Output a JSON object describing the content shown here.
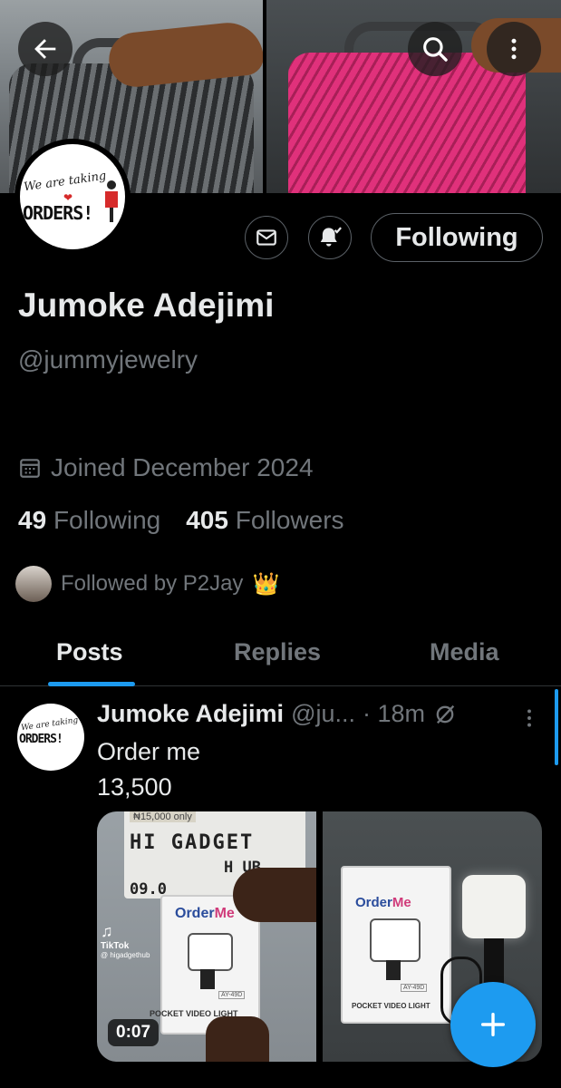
{
  "profile": {
    "name": "Jumoke Adejimi",
    "handle": "@jummyjewelry",
    "joined": "Joined December 2024",
    "following_count": "49",
    "following_label": "Following",
    "followers_count": "405",
    "followers_label": "Followers",
    "followed_by": "Followed by P2Jay",
    "followed_by_emoji": "👑",
    "logo_line1": "We are taking",
    "logo_line2": "ORDERS!"
  },
  "actions": {
    "following_button": "Following"
  },
  "tabs": [
    {
      "label": "Posts",
      "active": true
    },
    {
      "label": "Replies",
      "active": false
    },
    {
      "label": "Media",
      "active": false
    }
  ],
  "post": {
    "author": "Jumoke Adejimi",
    "handle": "@ju...",
    "time": "· 18m",
    "text_line1": "Order me",
    "text_line2": "13,500",
    "video_duration": "0:07",
    "media_left": {
      "price_tag": "₦15,000 only",
      "sign_line1": "HI GADGET",
      "sign_line2": "H UB",
      "sign_line3": "09.0",
      "tiktok": "TikTok",
      "tiktok_handle": "@ higadgethub",
      "box_brand_a": "Order",
      "box_brand_b": "Me",
      "box_model": "AY-49D",
      "box_caption": "POCKET VIDEO LIGHT"
    },
    "media_right": {
      "box_brand_a": "Order",
      "box_brand_b": "Me",
      "box_model": "AY-49D",
      "box_caption": "POCKET VIDEO LIGHT"
    }
  },
  "colors": {
    "accent": "#1d9bf0",
    "muted": "#71767b",
    "text": "#e7e9ea",
    "background": "#000000"
  }
}
